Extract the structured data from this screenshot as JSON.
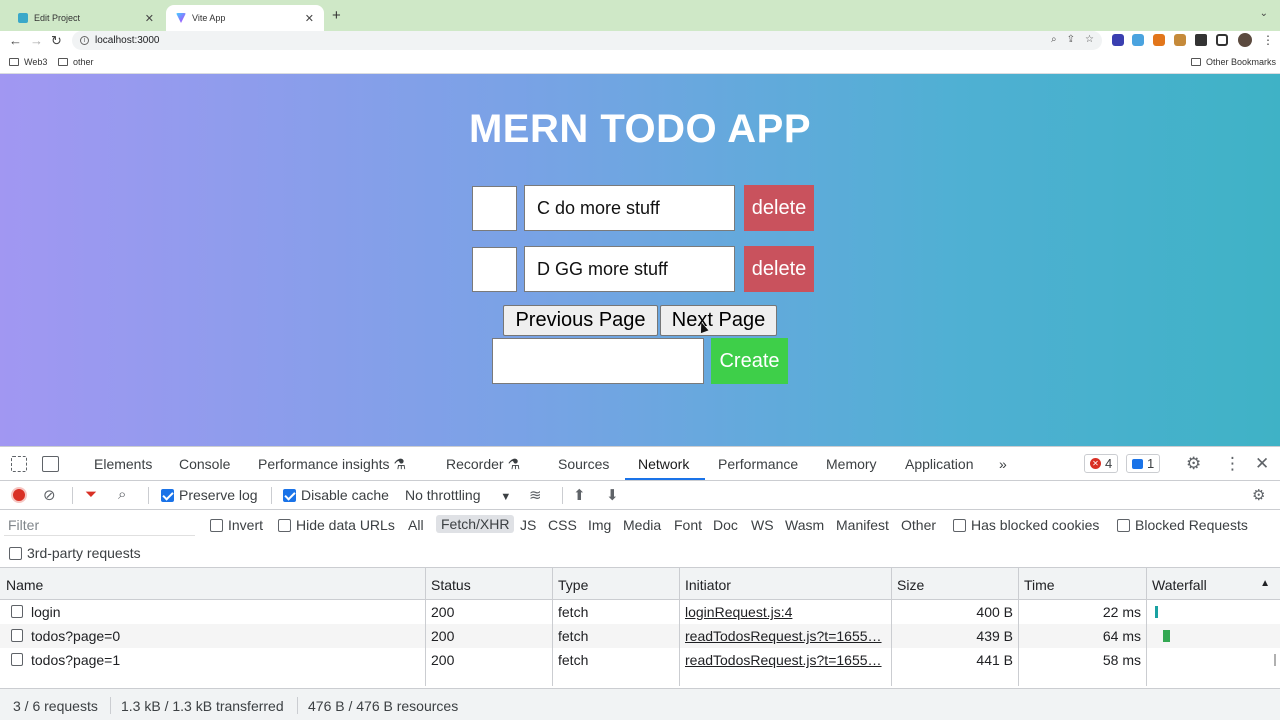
{
  "browser": {
    "tabs": [
      {
        "title": "Edit Project",
        "close": "✕"
      },
      {
        "title": "Vite App",
        "close": "✕"
      }
    ],
    "new_tab": "+",
    "url": "localhost:3000",
    "bookmarks": [
      "Web3",
      "other"
    ],
    "other_bookmarks": "Other Bookmarks"
  },
  "app": {
    "title": "MERN TODO APP",
    "todos": [
      {
        "text": "C do more stuff",
        "delete_label": "delete"
      },
      {
        "text": "D GG more stuff",
        "delete_label": "delete"
      }
    ],
    "prev_label": "Previous Page",
    "next_label": "Next Page",
    "create_label": "Create",
    "colors": {
      "delete": "#c9525d",
      "create": "#3ecf49"
    }
  },
  "devtools": {
    "tabs": [
      "Elements",
      "Console",
      "Performance insights",
      "Recorder",
      "Sources",
      "Network",
      "Performance",
      "Memory",
      "Application"
    ],
    "active_tab": "Network",
    "more": "»",
    "errors_count": "4",
    "messages_count": "1",
    "toolbar": {
      "preserve_log": "Preserve log",
      "disable_cache": "Disable cache",
      "throttling": "No throttling"
    },
    "filter": {
      "placeholder": "Filter",
      "invert": "Invert",
      "hide_data_urls": "Hide data URLs",
      "types": [
        "All",
        "Fetch/XHR",
        "JS",
        "CSS",
        "Img",
        "Media",
        "Font",
        "Doc",
        "WS",
        "Wasm",
        "Manifest",
        "Other"
      ],
      "selected_type": "Fetch/XHR",
      "has_blocked_cookies": "Has blocked cookies",
      "blocked_requests": "Blocked Requests",
      "third_party": "3rd-party requests"
    },
    "table": {
      "columns": [
        "Name",
        "Status",
        "Type",
        "Initiator",
        "Size",
        "Time",
        "Waterfall"
      ],
      "rows": [
        {
          "name": "login",
          "status": "200",
          "type": "fetch",
          "initiator": "loginRequest.js:4",
          "size": "400 B",
          "time": "22 ms"
        },
        {
          "name": "todos?page=0",
          "status": "200",
          "type": "fetch",
          "initiator": "readTodosRequest.js?t=1655…",
          "size": "439 B",
          "time": "64 ms"
        },
        {
          "name": "todos?page=1",
          "status": "200",
          "type": "fetch",
          "initiator": "readTodosRequest.js?t=1655…",
          "size": "441 B",
          "time": "58 ms"
        }
      ]
    },
    "status": {
      "requests": "3 / 6 requests",
      "transferred": "1.3 kB / 1.3 kB transferred",
      "resources": "476 B / 476 B resources"
    }
  }
}
